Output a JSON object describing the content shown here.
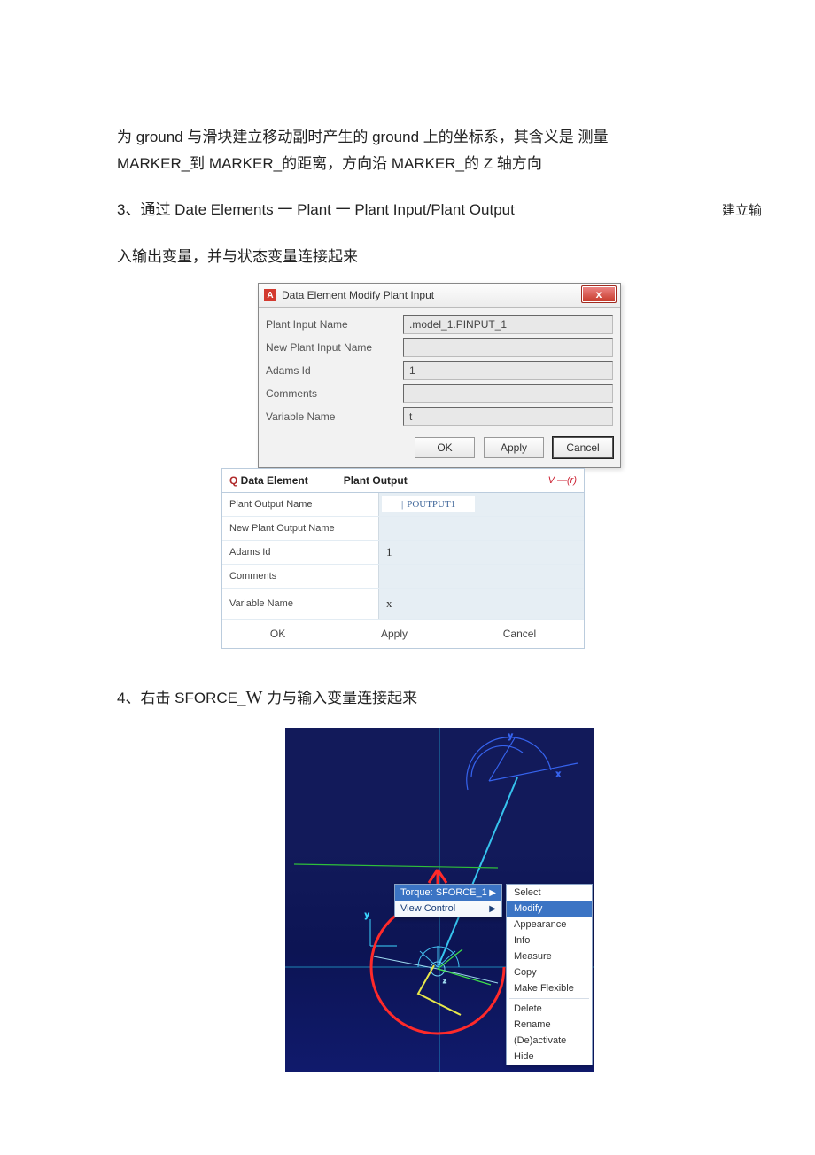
{
  "para1_l1": "为 ground 与滑块建立移动副时产生的 ground 上的坐标系，其含义是  测量",
  "para1_l2": "MARKER_到 MARKER_的距离，方向沿 MARKER_的  Z 轴方向",
  "step3_main": "3、通过  Date Elements 一  Plant 一  Plant Input/Plant Output",
  "step3_right": "建立输",
  "step3_cont": "入输出变量，并与状态变量连接起来",
  "dlg1": {
    "icon": "A",
    "title": "Data Element Modify Plant Input",
    "close": "x",
    "labels": {
      "name": "Plant Input Name",
      "newname": "New Plant Input Name",
      "adamsid": "Adams Id",
      "comments": "Comments",
      "varname": "Variable Name"
    },
    "values": {
      "name": ".model_1.PINPUT_1",
      "newname": "",
      "adamsid": "1",
      "comments": "",
      "varname": "t"
    },
    "buttons": {
      "ok": "OK",
      "apply": "Apply",
      "cancel": "Cancel"
    }
  },
  "dlg2": {
    "q_label": "Q Data Element",
    "title": "Plant Output",
    "v_label": "V —(r)",
    "labels": {
      "name": "Plant Output Name",
      "newname": "New Plant Output Name",
      "adamsid": "Adams Id",
      "comments": "Comments",
      "varname": "Variable Name"
    },
    "values": {
      "name_chip_caret": "|",
      "name_chip": "POUTPUT1",
      "newname": "",
      "adamsid": "1",
      "comments": "",
      "varname": "x"
    },
    "buttons": {
      "ok": "OK",
      "apply": "Apply",
      "cancel": "Cancel"
    }
  },
  "step4": "4、右击 SFORCE_W 力与输入变量连接起来",
  "step4_pre": "4、右击 SFORCE_",
  "step4_W": "W",
  "step4_post": " 力与输入变量连接起来",
  "ctx1": {
    "item1": "Torque: SFORCE_1",
    "item2": "View Control"
  },
  "ctx2": {
    "select": "Select",
    "modify": "Modify",
    "appearance": "Appearance",
    "info": "Info",
    "measure": "Measure",
    "copy": "Copy",
    "makeflexible": "Make Flexible",
    "delete": "Delete",
    "rename": "Rename",
    "deactivate": "(De)activate",
    "hide": "Hide"
  }
}
